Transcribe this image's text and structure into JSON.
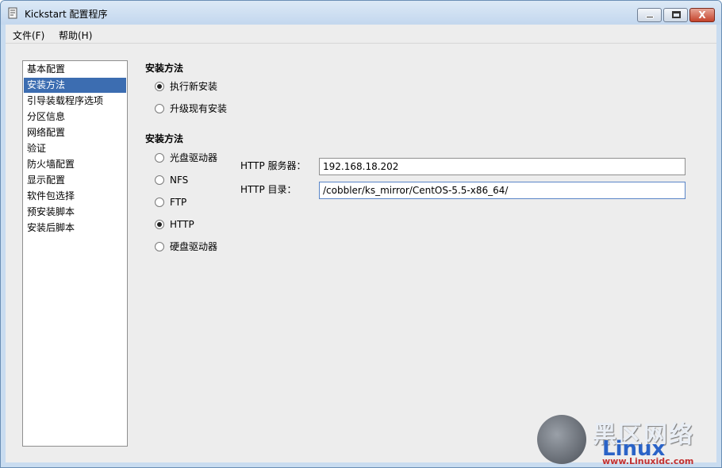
{
  "window": {
    "title": "Kickstart 配置程序",
    "close_glyph": "X"
  },
  "menu": {
    "file": "文件(F)",
    "help": "帮助(H)"
  },
  "sidebar": {
    "items": [
      {
        "label": "基本配置"
      },
      {
        "label": "安装方法"
      },
      {
        "label": "引导装载程序选项"
      },
      {
        "label": "分区信息"
      },
      {
        "label": "网络配置"
      },
      {
        "label": "验证"
      },
      {
        "label": "防火墙配置"
      },
      {
        "label": "显示配置"
      },
      {
        "label": "软件包选择"
      },
      {
        "label": "预安装脚本"
      },
      {
        "label": "安装后脚本"
      }
    ],
    "selected_index": 1
  },
  "install_type": {
    "title": "安装方法",
    "options": [
      {
        "label": "执行新安装",
        "checked": true
      },
      {
        "label": "升级现有安装",
        "checked": false
      }
    ]
  },
  "install_source": {
    "title": "安装方法",
    "options": [
      {
        "label": "光盘驱动器",
        "checked": false
      },
      {
        "label": "NFS",
        "checked": false
      },
      {
        "label": "FTP",
        "checked": false
      },
      {
        "label": "HTTP",
        "checked": true
      },
      {
        "label": "硬盘驱动器",
        "checked": false
      }
    ]
  },
  "http": {
    "server_label": "HTTP 服务器：",
    "server_value": "192.168.18.202",
    "dir_label": "HTTP 目录：",
    "dir_value": "/cobbler/ks_mirror/CentOS-5.5-x86_64/"
  },
  "watermark": {
    "top": "黑区网络",
    "mid": "Linux",
    "url": "www.Linuxidc.com"
  },
  "colors": {
    "selection": "#3c6db1",
    "title_bar": "#c9dcf0",
    "client_bg": "#ededed"
  }
}
